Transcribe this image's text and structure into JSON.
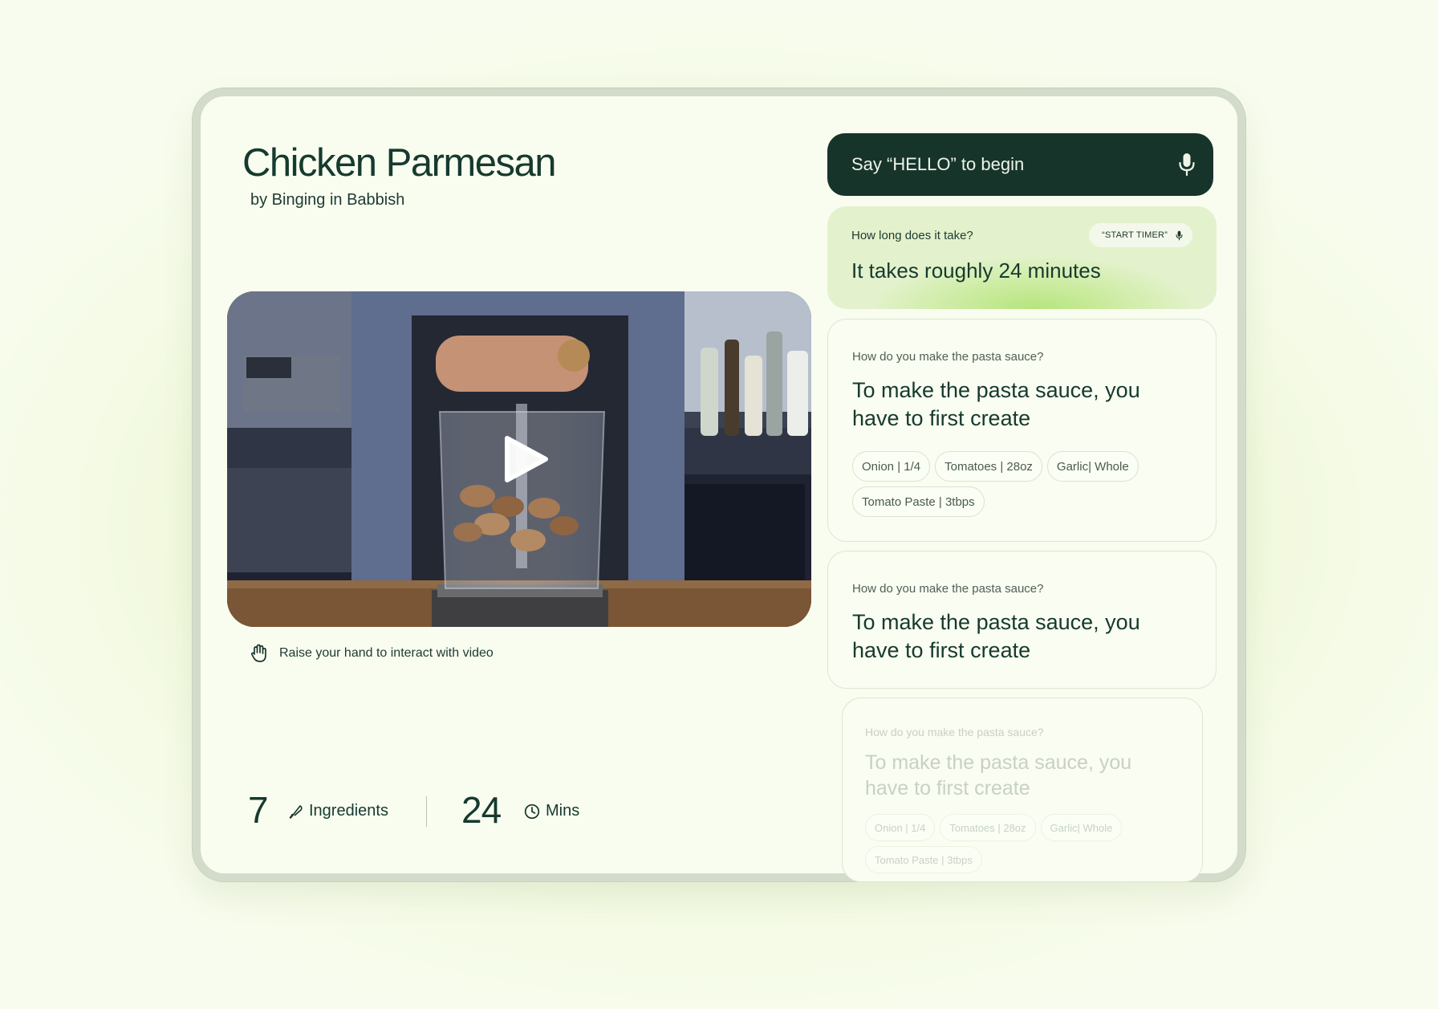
{
  "recipe": {
    "title": "Chicken Parmesan",
    "byline": "by Binging in Babbish",
    "video_hint": "Raise your hand to interact with video",
    "stats": {
      "ingredients_count": "7",
      "ingredients_label": "Ingredients",
      "time_value": "24",
      "time_label": "Mins"
    }
  },
  "assistant": {
    "prompt": "Say “HELLO” to begin",
    "current": {
      "question": "How long does it take?",
      "answer": "It takes roughly 24 minutes",
      "action_chip": "“START TIMER”"
    },
    "history": [
      {
        "question": "How do you make the pasta sauce?",
        "answer": "To make the pasta sauce, you have to first create",
        "chips": [
          "Onion | 1/4",
          "Tomatoes | 28oz",
          "Garlic| Whole",
          "Tomato Paste | 3tbps"
        ]
      },
      {
        "question": "How do you make the pasta sauce?",
        "answer": "To make the pasta sauce, you have to first create"
      },
      {
        "question": "How do you make the pasta sauce?",
        "answer": "To make the pasta sauce, you have to first create",
        "chips": [
          "Onion | 1/4",
          "Tomatoes | 28oz",
          "Garlic| Whole",
          "Tomato Paste | 3tbps"
        ]
      }
    ]
  },
  "colors": {
    "dark_green": "#17342b",
    "accent_lime": "#b6e47d",
    "background": "#f9fdf0"
  },
  "icons": [
    "microphone-icon",
    "play-icon",
    "hand-icon",
    "knife-icon",
    "clock-icon"
  ]
}
